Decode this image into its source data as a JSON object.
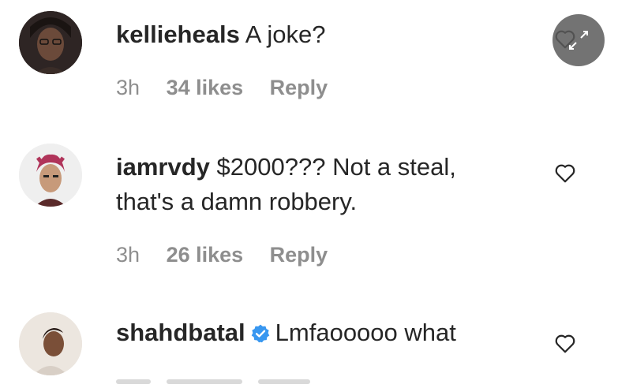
{
  "comments": [
    {
      "username": "kellieheals",
      "text": "A joke?",
      "time": "3h",
      "likes": "34 likes",
      "reply": "Reply"
    },
    {
      "username": "iamrvdy",
      "text": "$2000??? Not a steal,",
      "text2": "that's a damn robbery.",
      "time": "3h",
      "likes": "26 likes",
      "reply": "Reply"
    },
    {
      "username": "shahdbatal",
      "verified": true,
      "text": "Lmfaooooo what"
    }
  ],
  "icons": {
    "like": "heart-outline-icon",
    "expand": "expand-arrows-icon",
    "verified": "verified-badge-icon"
  },
  "colors": {
    "text": "#262626",
    "meta": "#8e8e8e",
    "verified": "#3897f0",
    "overlay": "#5a5a5a"
  }
}
